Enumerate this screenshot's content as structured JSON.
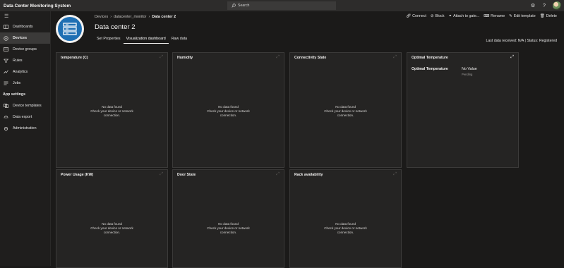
{
  "app": {
    "title": "Data Center Monitoring System"
  },
  "search": {
    "placeholder": "Search"
  },
  "topbar": {
    "icons": [
      "gear-icon",
      "help-icon",
      "avatar"
    ]
  },
  "sidebar": {
    "items": [
      {
        "label": "Dashboards",
        "icon": "dashboard-icon"
      },
      {
        "label": "Devices",
        "icon": "devices-icon",
        "active": true
      },
      {
        "label": "Device groups",
        "icon": "device-groups-icon"
      },
      {
        "label": "Rules",
        "icon": "rules-icon"
      },
      {
        "label": "Analytics",
        "icon": "analytics-icon"
      },
      {
        "label": "Jobs",
        "icon": "jobs-icon"
      }
    ],
    "section": "App settings",
    "settings_items": [
      {
        "label": "Device templates",
        "icon": "device-templates-icon"
      },
      {
        "label": "Data export",
        "icon": "data-export-icon"
      },
      {
        "label": "Administration",
        "icon": "administration-icon"
      }
    ]
  },
  "breadcrumb": {
    "items": [
      "Devices",
      "datacenter_monitor",
      "Data center 2"
    ]
  },
  "device": {
    "title": "Data center 2"
  },
  "tabs": [
    "Set Properties",
    "Visualization dashboard",
    "Raw data"
  ],
  "actions": [
    "Connect",
    "Block",
    "Attach to gate...",
    "Rename",
    "Edit template",
    "Delete"
  ],
  "status": {
    "text": "Last data received: N/A  |  Status: Registered"
  },
  "nodata": {
    "line1": "No data found",
    "line2": "Check your device or network",
    "line3": "connection."
  },
  "tiles": [
    {
      "title": "temperature (C)"
    },
    {
      "title": "Humidity"
    },
    {
      "title": "Connectivity State"
    },
    {
      "title": "Optimal Temperature",
      "label": "Optimal Temperature",
      "value": "No Value",
      "sub": "Pending"
    },
    {
      "title": "Power Usage (KW)"
    },
    {
      "title": "Door State"
    },
    {
      "title": "Rack availability"
    }
  ]
}
